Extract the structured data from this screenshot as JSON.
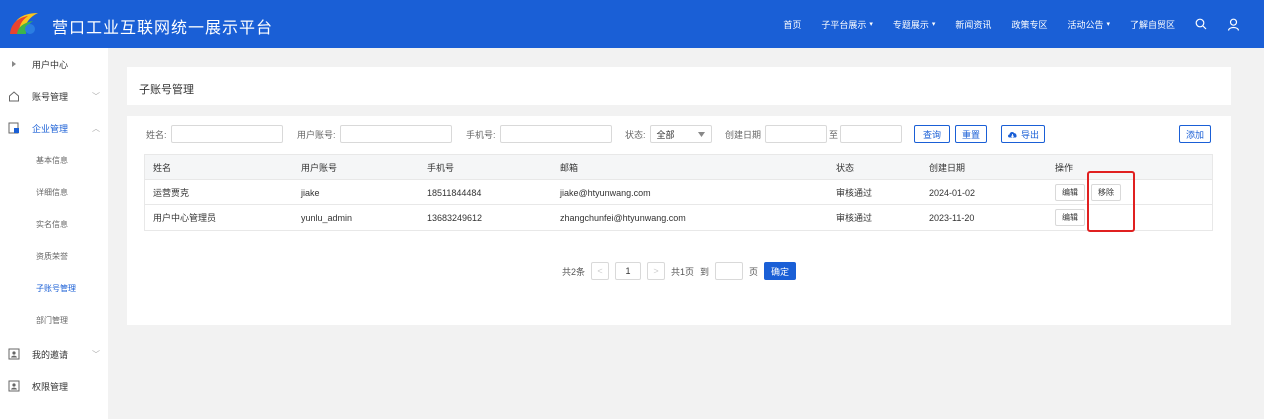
{
  "header": {
    "brand": "营口工业互联网统一展示平台",
    "nav": [
      {
        "label": "首页",
        "caret": false
      },
      {
        "label": "子平台展示",
        "caret": true
      },
      {
        "label": "专题展示",
        "caret": true
      },
      {
        "label": "新闻资讯",
        "caret": false
      },
      {
        "label": "政策专区",
        "caret": false
      },
      {
        "label": "活动公告",
        "caret": true
      },
      {
        "label": "了解自贸区",
        "caret": false
      }
    ],
    "caret_glyph": "▾"
  },
  "sidebar": {
    "items": [
      {
        "label": "用户中心",
        "icon": "triangle-right-icon"
      },
      {
        "label": "账号管理",
        "icon": "home-icon",
        "chevron": "﹀"
      },
      {
        "label": "企业管理",
        "icon": "enterprise-icon",
        "chevron": "︿"
      },
      {
        "label": "我的邀请",
        "icon": "invite-icon",
        "chevron": "﹀"
      },
      {
        "label": "权限管理",
        "icon": "permission-icon"
      }
    ],
    "sub_items": [
      "基本信息",
      "详细信息",
      "实名信息",
      "资质荣誉",
      "子账号管理",
      "部门管理"
    ],
    "active_sub": "子账号管理"
  },
  "page": {
    "title": "子账号管理"
  },
  "filters": {
    "name_label": "姓名:",
    "account_label": "用户账号:",
    "phone_label": "手机号:",
    "status_label": "状态:",
    "status_value": "全部",
    "date_label": "创建日期",
    "date_sep": "至",
    "query_label": "查询",
    "reset_label": "重置",
    "export_label": "导出",
    "add_label": "添加"
  },
  "table": {
    "columns": [
      "姓名",
      "用户账号",
      "手机号",
      "邮箱",
      "状态",
      "创建日期",
      "操作"
    ],
    "rows": [
      {
        "name": "运营贾克",
        "account": "jiake",
        "phone": "18511844484",
        "email": "jiake@htyunwang.com",
        "status": "审核通过",
        "date": "2024-01-02",
        "actions": [
          "编辑",
          "移除"
        ]
      },
      {
        "name": "用户中心管理员",
        "account": "yunlu_admin",
        "phone": "13683249612",
        "email": "zhangchunfei@htyunwang.com",
        "status": "审核通过",
        "date": "2023-11-20",
        "actions": [
          "编辑"
        ]
      }
    ]
  },
  "pagination": {
    "total": "共2条",
    "prev": "<",
    "current": "1",
    "next": ">",
    "pages": "共1页",
    "goto": "到",
    "page_unit": "页",
    "confirm": "确定"
  },
  "colors": {
    "primary": "#1a5fd6",
    "highlight": "#e02020"
  }
}
